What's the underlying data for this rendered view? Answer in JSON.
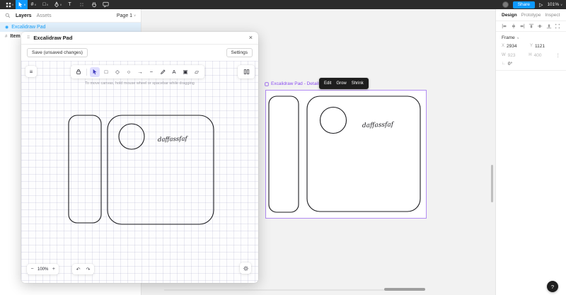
{
  "colors": {
    "accent_blue": "#0d99ff",
    "selection_purple": "#8a4cf0",
    "topbar_bg": "#2c2c2c",
    "selected_tool_bg": "#e0dfff"
  },
  "topbar": {
    "tools": [
      {
        "name": "main-menu"
      },
      {
        "name": "move",
        "selected": true
      },
      {
        "name": "frame",
        "glyph": "#"
      },
      {
        "name": "shape",
        "glyph": "□"
      },
      {
        "name": "pen"
      },
      {
        "name": "text",
        "glyph": "T"
      },
      {
        "name": "resources",
        "glyph": "∷"
      },
      {
        "name": "hand"
      },
      {
        "name": "comment"
      }
    ],
    "share_label": "Share",
    "zoom_value": "101%"
  },
  "sidebar": {
    "tabs": [
      {
        "label": "Layers"
      },
      {
        "label": "Assets"
      }
    ],
    "page_label": "Page 1",
    "layers": [
      {
        "name": "Excalidraw Pad",
        "selected": true
      },
      {
        "name": "Item",
        "selected": false
      }
    ]
  },
  "figma_canvas": {
    "frame_name": "Excalidraw Pad - Details",
    "context_toolbar": [
      {
        "label": "Edit"
      },
      {
        "label": "Grow"
      },
      {
        "label": "Shrink"
      }
    ],
    "drawing_text": "daffassfaf"
  },
  "modal": {
    "title": "Excalidraw Pad",
    "save_button": "Save (unsaved changes)",
    "settings_button": "Settings",
    "hint": "To move canvas, hold mouse wheel or spacebar while dragging",
    "drawing_text": "daffassfaf",
    "zoom_value": "100%",
    "tools": [
      {
        "name": "selection",
        "selected": true
      },
      {
        "name": "rectangle",
        "glyph": "□"
      },
      {
        "name": "diamond",
        "glyph": "◇"
      },
      {
        "name": "ellipse",
        "glyph": "○"
      },
      {
        "name": "arrow",
        "glyph": "→"
      },
      {
        "name": "line",
        "glyph": "−"
      },
      {
        "name": "draw"
      },
      {
        "name": "text",
        "glyph": "A"
      },
      {
        "name": "image",
        "glyph": "▣"
      },
      {
        "name": "eraser",
        "glyph": "▱"
      }
    ]
  },
  "inspector": {
    "tabs": [
      {
        "label": "Design"
      },
      {
        "label": "Prototype"
      },
      {
        "label": "Inspect"
      }
    ],
    "frame_section": {
      "title": "Frame",
      "x_label": "X",
      "x_value": "2934",
      "y_label": "Y",
      "y_value": "1121",
      "w_label": "W",
      "w_value": "923",
      "h_label": "H",
      "h_value": "400",
      "rotation_value": "0°"
    }
  },
  "help_label": "?",
  "glyphs": {
    "chevron": "∨",
    "close": "×",
    "kebab": "⋮",
    "drag_handle": "⠿",
    "hamburger": "≡",
    "minus": "−",
    "plus": "+",
    "undo": "↶",
    "redo": "↷",
    "play": "▷",
    "angle": "∟"
  }
}
